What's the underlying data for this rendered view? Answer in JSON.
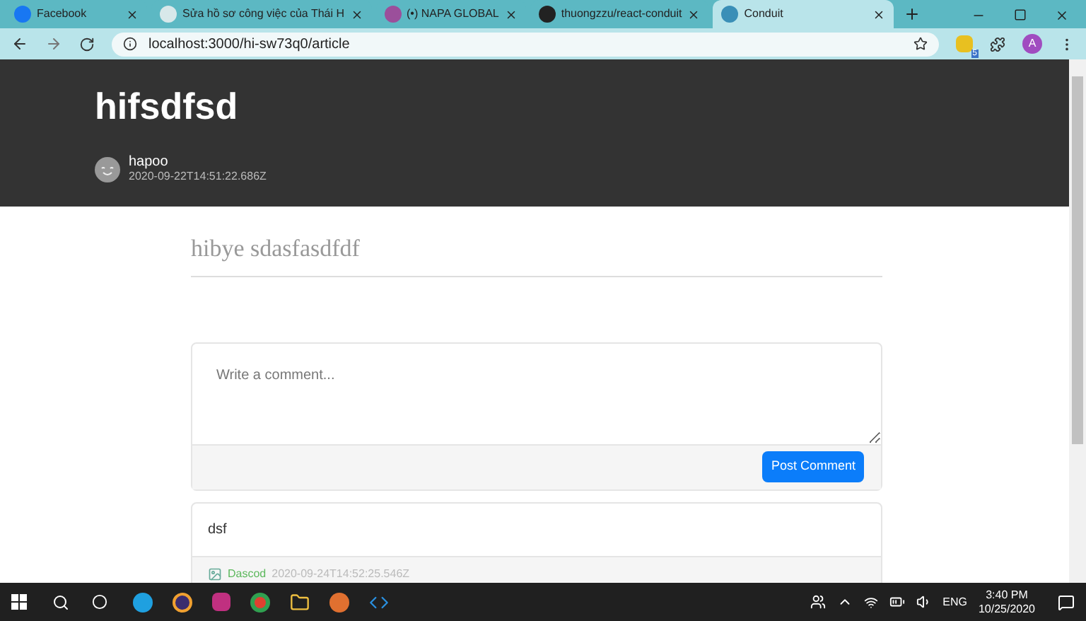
{
  "browser": {
    "tabs": [
      {
        "title": "Facebook",
        "selected": false
      },
      {
        "title": "Sửa hồ sơ công việc của Thái H",
        "selected": false
      },
      {
        "title": "(•) NAPA GLOBAL",
        "selected": false
      },
      {
        "title": "thuongzzu/react-conduit",
        "selected": false
      },
      {
        "title": "Conduit",
        "selected": true
      }
    ],
    "url": "localhost:3000/hi-sw73q0/article",
    "profile": "A",
    "extension_badge": "5"
  },
  "article": {
    "title": "hifsdfsd",
    "author": "hapoo",
    "date": "2020-09-22T14:51:22.686Z",
    "body": "hibye sdasfasdfdf"
  },
  "comment_form": {
    "placeholder": "Write a comment...",
    "button": "Post Comment"
  },
  "comments": [
    {
      "body": "dsf",
      "author": "Dascod",
      "date": "2020-09-24T14:52:25.546Z"
    }
  ],
  "taskbar": {
    "language": "ENG",
    "time": "3:40 PM",
    "date": "10/25/2020"
  }
}
